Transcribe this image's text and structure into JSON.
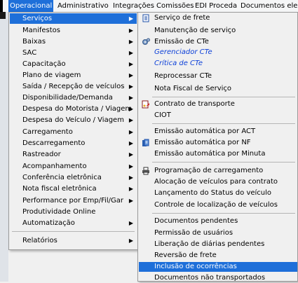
{
  "menubar": {
    "items": [
      {
        "label": "Operacional",
        "active": true
      },
      {
        "label": "Administrativo"
      },
      {
        "label": "Integrações"
      },
      {
        "label": "Comissões"
      },
      {
        "label": "EDI Proceda"
      },
      {
        "label": "Documentos ele"
      }
    ]
  },
  "dropdown": {
    "items": [
      {
        "label": "Serviços",
        "arrow": "▶",
        "highlighted": true
      },
      {
        "label": "Manifestos",
        "arrow": "▶"
      },
      {
        "label": "Baixas",
        "arrow": "▶"
      },
      {
        "label": "SAC",
        "arrow": "▶"
      },
      {
        "label": "Capacitação",
        "arrow": "▶"
      },
      {
        "label": "Plano de viagem",
        "arrow": "▶"
      },
      {
        "label": "Saída / Recepção de veículos",
        "arrow": "▶"
      },
      {
        "label": "Disponibilidade/Demanda",
        "arrow": "▶"
      },
      {
        "label": "Despesa do Motorista / Viagem",
        "arrow": "▶"
      },
      {
        "label": "Despesa do Veículo / Viagem",
        "arrow": "▶"
      },
      {
        "label": "Carregamento",
        "arrow": "▶"
      },
      {
        "label": "Descarregamento",
        "arrow": "▶"
      },
      {
        "label": "Rastreador",
        "arrow": "▶"
      },
      {
        "label": "Acompanhamento",
        "arrow": "▶"
      },
      {
        "label": "Conferência eletrônica",
        "arrow": "▶"
      },
      {
        "label": "Nota fiscal eletrônica",
        "arrow": "▶"
      },
      {
        "label": "Performance por Emp/Fil/Gar",
        "arrow": "▶"
      },
      {
        "label": "Produtividade Online",
        "arrow": ""
      },
      {
        "label": "Automatização",
        "arrow": "▶"
      },
      {
        "label": "Relatórios",
        "arrow": "▶"
      }
    ]
  },
  "submenu": {
    "items": [
      {
        "label": "Serviço de frete",
        "icon": "document-icon"
      },
      {
        "label": "Manutenção de serviço"
      },
      {
        "label": "Emissão de CTe",
        "icon": "gears-icon"
      },
      {
        "label": "Gerenciador CTe",
        "italic": true
      },
      {
        "label": "Crítica de CTe",
        "italic": true
      },
      {
        "label": "Reprocessar CTe"
      },
      {
        "label": "Nota Fiscal de Serviço"
      },
      {
        "label": "Contrato de transporte",
        "icon": "contract-icon"
      },
      {
        "label": "CIOT"
      },
      {
        "label": "Emissão automática por ACT"
      },
      {
        "label": "Emissão automática por NF",
        "icon": "documents-icon"
      },
      {
        "label": "Emissão automática por Minuta"
      },
      {
        "label": "Programação de carregamento",
        "icon": "printer-icon"
      },
      {
        "label": "Alocação de veículos para contrato"
      },
      {
        "label": "Lançamento do Status do veículo"
      },
      {
        "label": "Controle de localização de veículos"
      },
      {
        "label": "Documentos pendentes"
      },
      {
        "label": "Permissão de usuários"
      },
      {
        "label": "Liberação de diárias pendentes"
      },
      {
        "label": "Reversão de frete"
      },
      {
        "label": "Inclusão de ocorrências",
        "highlighted": true
      },
      {
        "label": "Documentos não transportados"
      }
    ]
  },
  "colors": {
    "highlight": "#1e6fd9",
    "italic_link": "#0b3fd8"
  }
}
